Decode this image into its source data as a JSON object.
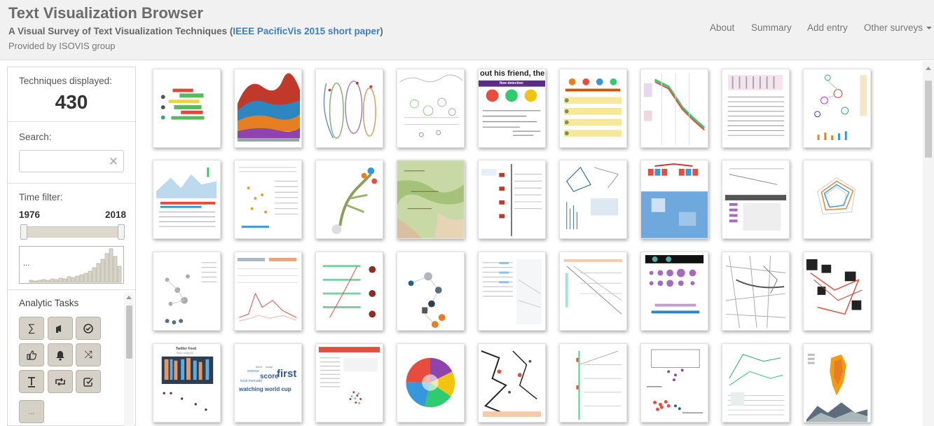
{
  "header": {
    "title": "Text Visualization Browser",
    "subtitle_prefix": "A Visual Survey of Text Visualization Techniques (",
    "subtitle_link": "IEEE PacificVis 2015 short paper",
    "subtitle_suffix": ")",
    "provider": "Provided by ISOVIS group",
    "nav": [
      "About",
      "Summary",
      "Add entry",
      "Other surveys"
    ]
  },
  "sidebar": {
    "techniques_label": "Techniques displayed:",
    "techniques_count": "430",
    "search_label": "Search:",
    "search_value": "",
    "search_clear_icon": "close-icon",
    "time_filter_label": "Time filter:",
    "year_min": "1976",
    "year_max": "2018",
    "histogram_overflow": "...",
    "analytic_tasks_label": "Analytic Tasks",
    "task_icons": [
      "sum-icon",
      "megaphone-icon",
      "check-circle-icon",
      "thumbs-up-icon",
      "bell-icon",
      "shuffle-icon",
      "text-cursor-icon",
      "retweet-icon",
      "edit-check-icon"
    ],
    "more_label": "..."
  },
  "thumbnail_text": {
    "t5_heading": "out his friend, the",
    "t5_bar": "flow detection",
    "t29_title": "Twitter Feed",
    "t29_sub": "Topic analysis",
    "t30_words": [
      "first",
      "score",
      "watching world cup",
      "local mercado",
      "science",
      "there",
      "ready"
    ]
  },
  "colors": {
    "header_bg": "#f1f1f1",
    "link": "#3a7fc1",
    "task_button": "#d6d1c6",
    "title_text": "#6b6b6b"
  }
}
